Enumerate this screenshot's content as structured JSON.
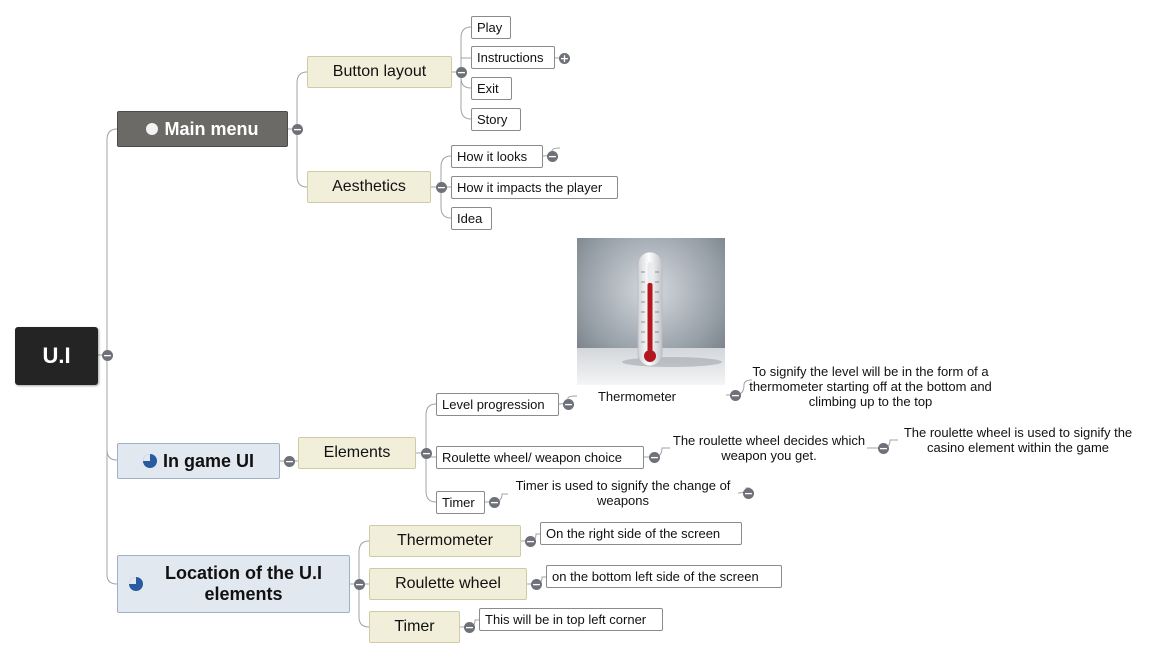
{
  "root": {
    "label": "U.I"
  },
  "main_menu": {
    "label": "Main menu",
    "button_layout": {
      "label": "Button layout",
      "items": [
        "Play",
        "Instructions",
        "Exit",
        "Story"
      ]
    },
    "aesthetics": {
      "label": "Aesthetics",
      "items": [
        "How it looks",
        "How it impacts the player",
        "Idea"
      ]
    }
  },
  "in_game_ui": {
    "label": "In game UI",
    "elements": {
      "label": "Elements",
      "level_progression": {
        "label": "Level progression",
        "image_caption": "Thermometer",
        "note": "To signify the level will be in the form of a thermometer starting off at the bottom and climbing up to the top"
      },
      "roulette": {
        "label": "Roulette wheel/ weapon choice",
        "note1": "The roulette wheel decides which weapon you get.",
        "note2": "The roulette wheel is used to signify the casino element within the game"
      },
      "timer": {
        "label": "Timer",
        "note": "Timer is used to signify the change of weapons"
      }
    }
  },
  "location": {
    "label": "Location of the U.I elements",
    "thermometer": {
      "label": "Thermometer",
      "detail": "On the right side of the screen"
    },
    "roulette": {
      "label": "Roulette wheel",
      "detail": "on the bottom left side of the screen"
    },
    "timer": {
      "label": "Timer",
      "detail": "This will be in top left corner"
    }
  },
  "icons": {
    "collapse": "minus-circle-icon",
    "expand": "plus-circle-icon",
    "thermometer_image": "thermometer-image"
  },
  "colors": {
    "root": "#242424",
    "main_menu": "#6b6a67",
    "branch_blue": "#e1e8f0",
    "subtopic": "#f1efd9",
    "connector": "#9a9a9a",
    "collapse": "#6e7178",
    "marker_blue": "#2a5aa0"
  }
}
